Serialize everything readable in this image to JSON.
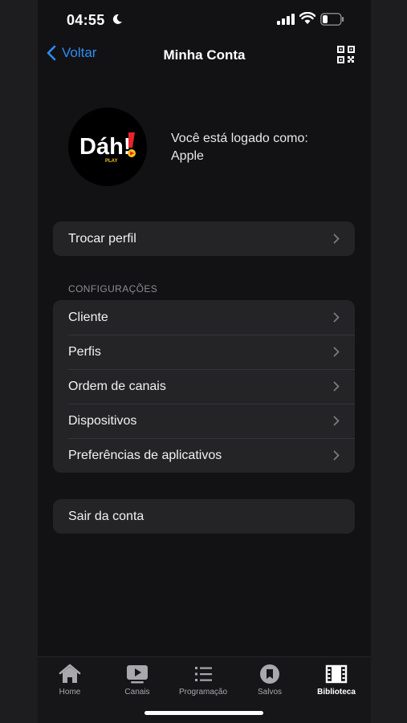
{
  "status_bar": {
    "time": "04:55"
  },
  "nav": {
    "back_label": "Voltar",
    "title": "Minha Conta"
  },
  "profile": {
    "logo_text": "Dáh!",
    "logo_sub": "PLAY",
    "logged_in_label": "Você está logado como:",
    "username": "Apple"
  },
  "switch_profile": {
    "label": "Trocar perfil"
  },
  "settings": {
    "section_title": "CONFIGURAÇÕES",
    "items": [
      {
        "label": "Cliente"
      },
      {
        "label": "Perfis"
      },
      {
        "label": "Ordem de canais"
      },
      {
        "label": "Dispositivos"
      },
      {
        "label": "Preferências de aplicativos"
      }
    ]
  },
  "logout": {
    "label": "Sair da conta"
  },
  "tab_bar": {
    "tabs": [
      {
        "label": "Home",
        "icon": "home-icon",
        "active": false
      },
      {
        "label": "Canais",
        "icon": "play-icon",
        "active": false
      },
      {
        "label": "Programação",
        "icon": "list-icon",
        "active": false
      },
      {
        "label": "Salvos",
        "icon": "bookmark-icon",
        "active": false
      },
      {
        "label": "Biblioteca",
        "icon": "film-icon",
        "active": true
      }
    ]
  },
  "colors": {
    "accent": "#2f8bf5",
    "background": "#121214",
    "group": "#242427",
    "logo_red": "#e8232a",
    "logo_yellow": "#f6c21a"
  }
}
